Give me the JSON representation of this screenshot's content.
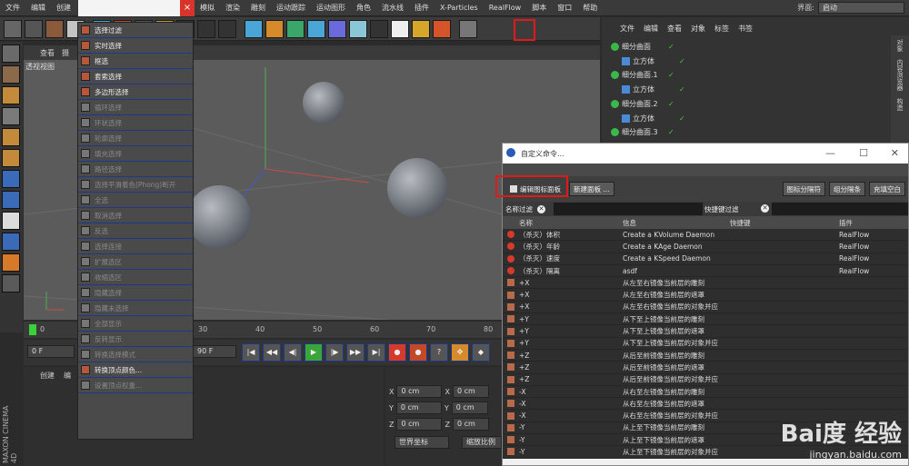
{
  "menubar": {
    "items": [
      "文件",
      "编辑",
      "创建",
      "模拟",
      "渲染",
      "雕刻",
      "运动跟踪",
      "运动图形",
      "角色",
      "流水线",
      "插件",
      "X-Particles",
      "RealFlow",
      "脚本",
      "窗口",
      "帮助"
    ],
    "interface_label": "界面:",
    "interface_value": "启动"
  },
  "viewport": {
    "menu": [
      "查看",
      "摄"
    ],
    "label": "透视视图"
  },
  "timeline": {
    "ticks": [
      "0",
      "30",
      "40",
      "50",
      "60",
      "70",
      "80"
    ]
  },
  "controls": {
    "start_frame": "0 F",
    "end_frame": "90 F"
  },
  "bottom": {
    "tabs": [
      "创建",
      "编"
    ],
    "coords": [
      {
        "axis": "X",
        "v1": "0 cm",
        "axis2": "X",
        "v2": "0 cm"
      },
      {
        "axis": "Y",
        "v1": "0 cm",
        "axis2": "Y",
        "v2": "0 cm"
      },
      {
        "axis": "Z",
        "v1": "0 cm",
        "axis2": "Z",
        "v2": "0 cm"
      }
    ],
    "world_coord": "世界坐标",
    "scale_btn": "缩放比例"
  },
  "dropdown": {
    "items": [
      {
        "label": "选择过滤",
        "enabled": true
      },
      {
        "label": "实时选择",
        "enabled": true
      },
      {
        "label": "框选",
        "enabled": true
      },
      {
        "label": "套索选择",
        "enabled": true
      },
      {
        "label": "多边形选择",
        "enabled": true
      },
      {
        "label": "循环选择",
        "enabled": false
      },
      {
        "label": "环状选择",
        "enabled": false
      },
      {
        "label": "轮廓选择",
        "enabled": false
      },
      {
        "label": "填充选择",
        "enabled": false
      },
      {
        "label": "路径选择",
        "enabled": false
      },
      {
        "label": "选择平滑着色(Phong)断开",
        "enabled": false
      },
      {
        "label": "全选",
        "enabled": false
      },
      {
        "label": "取消选择",
        "enabled": false
      },
      {
        "label": "反选",
        "enabled": false
      },
      {
        "label": "选择连接",
        "enabled": false
      },
      {
        "label": "扩展选区",
        "enabled": false
      },
      {
        "label": "收缩选区",
        "enabled": false
      },
      {
        "label": "隐藏选择",
        "enabled": false
      },
      {
        "label": "隐藏未选择",
        "enabled": false
      },
      {
        "label": "全部显示",
        "enabled": false
      },
      {
        "label": "反转显示",
        "enabled": false
      },
      {
        "label": "转换选择模式",
        "enabled": false
      },
      {
        "label": "转换顶点颜色...",
        "enabled": true
      },
      {
        "label": "设置顶点权重...",
        "enabled": false
      }
    ]
  },
  "object_manager": {
    "menu": [
      "文件",
      "编辑",
      "查看",
      "对象",
      "标签",
      "书签"
    ],
    "rows": [
      {
        "name": "细分曲面",
        "indent": 0
      },
      {
        "name": "立方体",
        "indent": 1
      },
      {
        "name": "细分曲面.1",
        "indent": 0
      },
      {
        "name": "立方体",
        "indent": 1
      },
      {
        "name": "细分曲面.2",
        "indent": 0
      },
      {
        "name": "立方体",
        "indent": 1
      },
      {
        "name": "细分曲面.3",
        "indent": 0
      }
    ],
    "side_tabs": [
      "对象",
      "内容浏览器",
      "构造"
    ]
  },
  "dialog": {
    "title": "自定义命令...",
    "edit_palette_btn": "编辑图标面板",
    "new_panel_btn": "新建面板 ...",
    "right_btns": [
      "图标分隔符",
      "组分隔条",
      "充填空白"
    ],
    "name_filter": "名称过滤",
    "shortcut_filter": "快捷键过滤",
    "columns": [
      "名称",
      "信息",
      "快捷键",
      "插件"
    ],
    "rows": [
      {
        "name": "（杀灭）体积",
        "info": "Create a KVolume Daemon",
        "plugin": "RealFlow"
      },
      {
        "name": "（杀灭）年龄",
        "info": "Create a KAge Daemon",
        "plugin": "RealFlow"
      },
      {
        "name": "（杀灭）速度",
        "info": "Create a KSpeed Daemon",
        "plugin": "RealFlow"
      },
      {
        "name": "（杀灭）隔离",
        "info": "asdf",
        "plugin": "RealFlow"
      },
      {
        "name": "+X",
        "info": "从左至右镜像当前层的雕刻",
        "plugin": ""
      },
      {
        "name": "+X",
        "info": "从左至右镜像当前层的遮罩",
        "plugin": ""
      },
      {
        "name": "+X",
        "info": "从左至右镜像当前层的对象并应",
        "plugin": ""
      },
      {
        "name": "+Y",
        "info": "从下至上镜像当前层的雕刻",
        "plugin": ""
      },
      {
        "name": "+Y",
        "info": "从下至上镜像当前层的遮罩",
        "plugin": ""
      },
      {
        "name": "+Y",
        "info": "从下至上镜像当前层的对象并应",
        "plugin": ""
      },
      {
        "name": "+Z",
        "info": "从后至前镜像当前层的雕刻",
        "plugin": ""
      },
      {
        "name": "+Z",
        "info": "从后至前镜像当前层的遮罩",
        "plugin": ""
      },
      {
        "name": "+Z",
        "info": "从后至前镜像当前层的对象并应",
        "plugin": ""
      },
      {
        "name": "-X",
        "info": "从右至左镜像当前层的雕刻",
        "plugin": ""
      },
      {
        "name": "-X",
        "info": "从右至左镜像当前层的遮罩",
        "plugin": ""
      },
      {
        "name": "-X",
        "info": "从右至左镜像当前层的对象并应",
        "plugin": ""
      },
      {
        "name": "-Y",
        "info": "从上至下镜像当前层的雕刻",
        "plugin": ""
      },
      {
        "name": "-Y",
        "info": "从上至下镜像当前层的遮罩",
        "plugin": ""
      },
      {
        "name": "-Y",
        "info": "从上至下镜像当前层的对象并应",
        "plugin": ""
      }
    ]
  },
  "watermark": {
    "brand": "Bai度 经验",
    "url": "jingyan.baidu.com"
  },
  "logo": "MAXON CINEMA 4D",
  "colors": {
    "highlight_red": "#e01a1a",
    "accent_blue": "#1d3a8a"
  }
}
